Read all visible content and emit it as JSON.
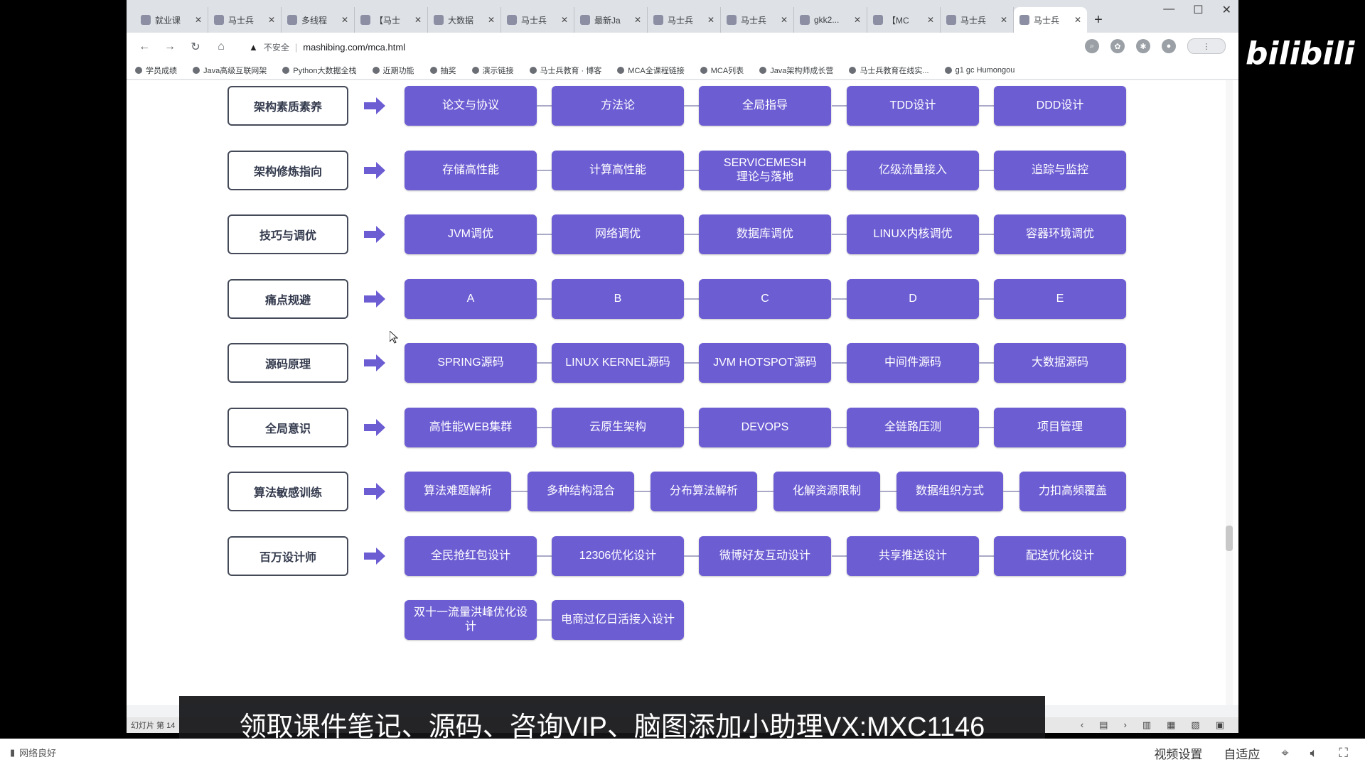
{
  "browser": {
    "tabs": [
      {
        "icon": "page-icon",
        "title": "就业课"
      },
      {
        "icon": "page-icon",
        "title": "马士兵"
      },
      {
        "icon": "page-icon",
        "title": "多线程"
      },
      {
        "icon": "page-icon",
        "title": "【马士"
      },
      {
        "icon": "page-icon",
        "title": "大数据"
      },
      {
        "icon": "page-icon",
        "title": "马士兵"
      },
      {
        "icon": "page-icon",
        "title": "最新Ja"
      },
      {
        "icon": "page-icon",
        "title": "马士兵"
      },
      {
        "icon": "page-icon",
        "title": "马士兵"
      },
      {
        "icon": "page-icon",
        "title": "gkk2..."
      },
      {
        "icon": "page-icon",
        "title": "【MC"
      },
      {
        "icon": "page-icon",
        "title": "马士兵"
      },
      {
        "icon": "page-icon",
        "title": "马士兵",
        "active": true
      }
    ],
    "new_tab": "+",
    "window_controls": {
      "minimize": "—",
      "maximize": "☐",
      "close": "✕"
    },
    "address": {
      "security": "不安全",
      "url": "mashibing.com/mca.html"
    },
    "bookmarks": [
      "学员成绩",
      "Java高级互联网架",
      "Python大数据全栈",
      "近期功能",
      "抽奖",
      "演示链接",
      "马士兵教育 · 博客",
      "MCA全课程链接",
      "MCA列表",
      "Java架构师成长营",
      "马士兵教育在线实...",
      "g1 gc Humongou"
    ]
  },
  "roadmap": {
    "rows": [
      {
        "label": "架构素质素养",
        "nodes": [
          "论文与协议",
          "方法论",
          "全局指导",
          "TDD设计",
          "DDD设计"
        ]
      },
      {
        "label": "架构修炼指向",
        "nodes": [
          "存储高性能",
          "计算高性能",
          "SERVICEMESH\n理论与落地",
          "亿级流量接入",
          "追踪与监控"
        ]
      },
      {
        "label": "技巧与调优",
        "nodes": [
          "JVM调优",
          "网络调优",
          "数据库调优",
          "LINUX内核调优",
          "容器环境调优"
        ]
      },
      {
        "label": "痛点规避",
        "nodes": [
          "A",
          "B",
          "C",
          "D",
          "E"
        ]
      },
      {
        "label": "源码原理",
        "nodes": [
          "SPRING源码",
          "LINUX KERNEL源码",
          "JVM HOTSPOT源码",
          "中间件源码",
          "大数据源码"
        ]
      },
      {
        "label": "全局意识",
        "nodes": [
          "高性能WEB集群",
          "云原生架构",
          "DEVOPS",
          "全链路压测",
          "项目管理"
        ]
      },
      {
        "label": "算法敏感训练",
        "nodes": [
          "算法难题解析",
          "多种结构混合",
          "分布算法解析",
          "化解资源限制",
          "数据组织方式",
          "力扣高频覆盖"
        ]
      },
      {
        "label": "百万设计师",
        "nodes": [
          "全民抢红包设计",
          "12306优化设计",
          "微博好友互动设计",
          "共享推送设计",
          "配送优化设计"
        ]
      },
      {
        "label": "",
        "nodes": [
          "双十一流量洪峰优化设计",
          "电商过亿日活接入设计"
        ]
      }
    ]
  },
  "slideshow_bar": {
    "left": "幻灯片 第 14",
    "right_icons": [
      "prev-icon",
      "page-icon",
      "next-icon",
      "view-normal-icon",
      "view-grid-icon",
      "view-reading-icon",
      "view-slideshow-icon"
    ]
  },
  "subtitle": "领取课件笔记、源码、咨询VIP、脑图添加小助理VX:MXC1146",
  "player": {
    "status": "网络良好",
    "video_settings": "视频设置",
    "fit": "自适应"
  },
  "logo": {
    "text": "bilibili"
  },
  "colors": {
    "node": "#6c5dd3",
    "label_border": "#444a58",
    "accent": "#00a1d6"
  }
}
